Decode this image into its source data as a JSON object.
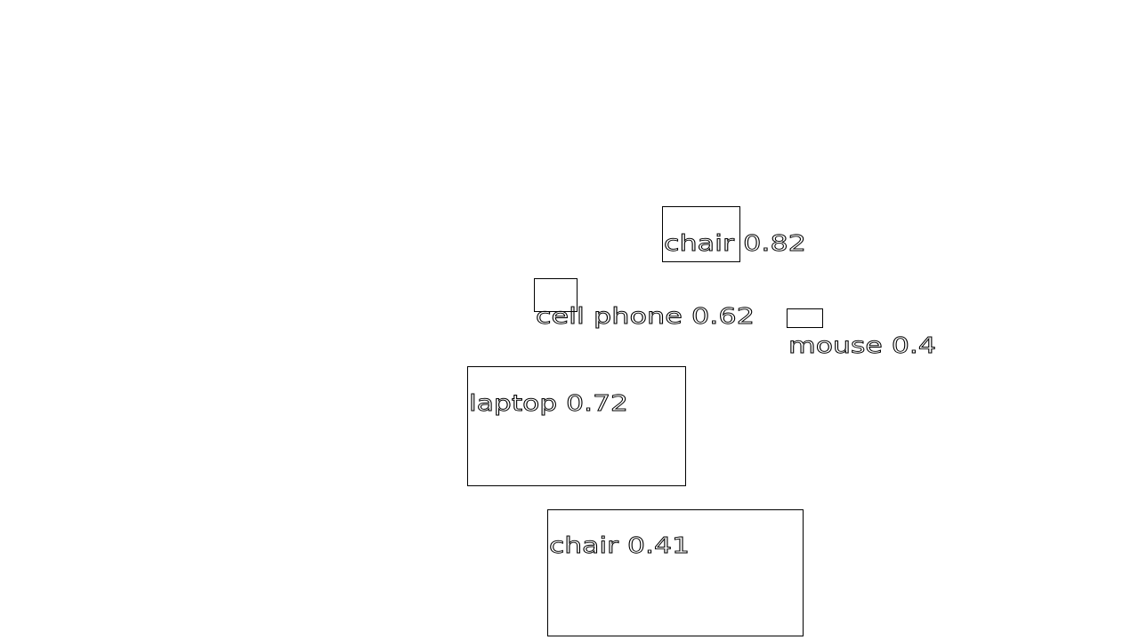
{
  "detections": [
    {
      "label": "chair",
      "score": "0.82"
    },
    {
      "label": "cell phone",
      "score": "0.62"
    },
    {
      "label": "mouse",
      "score": "0.4"
    },
    {
      "label": "laptop",
      "score": "0.72"
    },
    {
      "label": "chair",
      "score": "0.41"
    }
  ],
  "colors": {
    "background": "#ffffff",
    "box": "#000000",
    "text": "#000000"
  }
}
